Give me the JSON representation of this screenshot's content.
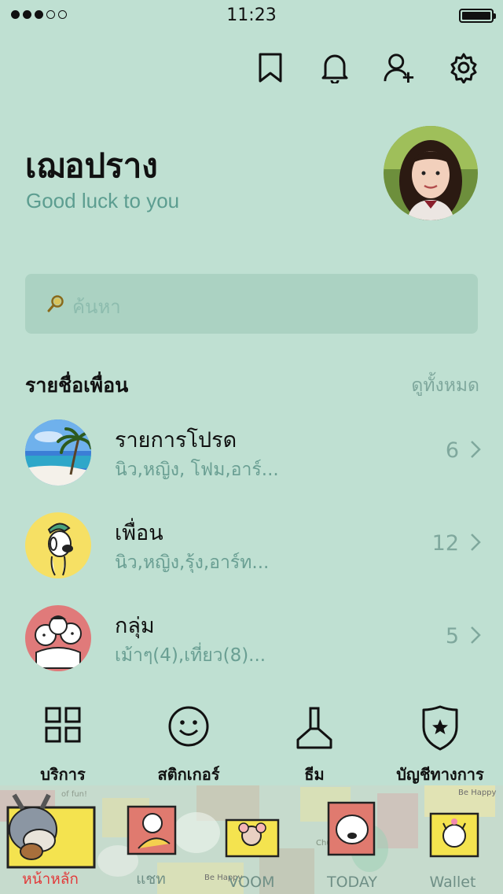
{
  "status_bar": {
    "time": "11:23",
    "signal_dots_filled": 3,
    "signal_dots_total": 5,
    "battery_level": 1.0
  },
  "header_icons": [
    "bookmark-icon",
    "bell-icon",
    "add-friend-icon",
    "gear-icon"
  ],
  "profile": {
    "name": "เฌอปราง",
    "status_message": "Good luck to you"
  },
  "search": {
    "placeholder": "ค้นหา"
  },
  "friends_section": {
    "title": "รายชื่อเพื่อน",
    "see_all": "ดูทั้งหมด",
    "rows": [
      {
        "title": "รายการโปรด",
        "subtitle": "นิว,หญิง, โฟม,อาร์...",
        "count": "6"
      },
      {
        "title": "เพื่อน",
        "subtitle": "นิว,หญิง,รุ้ง,อาร์ท...",
        "count": "12"
      },
      {
        "title": "กลุ่ม",
        "subtitle": "เม้าๆ(4),เที่ยว(8)...",
        "count": "5"
      }
    ]
  },
  "shortcuts": [
    {
      "label": "บริการ",
      "icon": "grid-icon"
    },
    {
      "label": "สติกเกอร์",
      "icon": "smiley-icon"
    },
    {
      "label": "ธีม",
      "icon": "brush-icon"
    },
    {
      "label": "บัญชีทางการ",
      "icon": "shield-star-icon"
    }
  ],
  "tab_bar": {
    "tabs": [
      {
        "label": "หน้าหลัก",
        "active": true
      },
      {
        "label": "แชท",
        "active": false
      },
      {
        "label": "VOOM",
        "active": false
      },
      {
        "label": "TODAY",
        "active": false
      },
      {
        "label": "Wallet",
        "active": false
      }
    ],
    "background_text": [
      "Be Happy",
      "Be Happy",
      "Chu Chu",
      "of fun!"
    ]
  },
  "colors": {
    "background": "#bfe0d2",
    "accent_secondary": "#5c9d90",
    "active_tab": "#e23a3a"
  }
}
